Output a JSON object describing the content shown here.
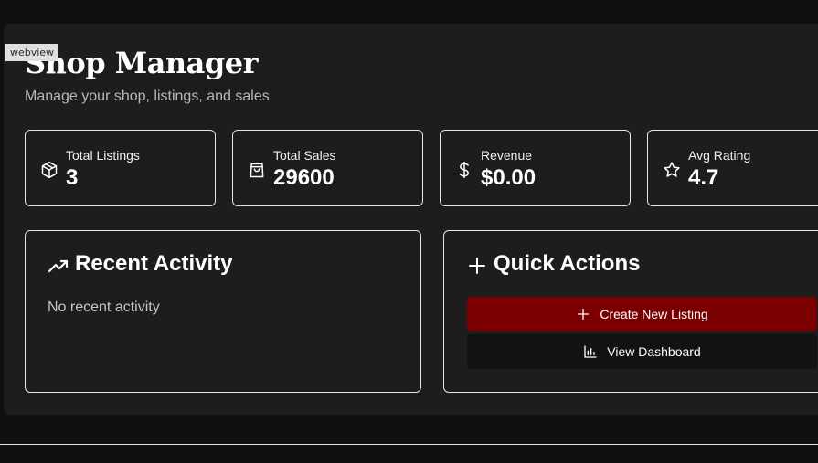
{
  "webview_tag": "webview",
  "header": {
    "title": "Shop Manager",
    "subtitle": "Manage your shop, listings, and sales"
  },
  "stats": [
    {
      "label": "Total Listings",
      "value": "3",
      "icon": "package-icon"
    },
    {
      "label": "Total Sales",
      "value": "29600",
      "icon": "shopping-bag-icon"
    },
    {
      "label": "Revenue",
      "value": "$0.00",
      "icon": "dollar-icon"
    },
    {
      "label": "Avg Rating",
      "value": "4.7",
      "icon": "star-icon"
    }
  ],
  "recent_activity": {
    "title": "Recent Activity",
    "icon": "trending-up-icon",
    "empty_text": "No recent activity"
  },
  "quick_actions": {
    "title": "Quick Actions",
    "icon": "plus-icon",
    "create_label": "Create New Listing",
    "dashboard_label": "View Dashboard"
  },
  "colors": {
    "background": "#0f1010",
    "panel": "#1d1d1d",
    "primary_button": "#7a0000",
    "secondary_button": "#111212",
    "border": "#e6e6e6"
  }
}
